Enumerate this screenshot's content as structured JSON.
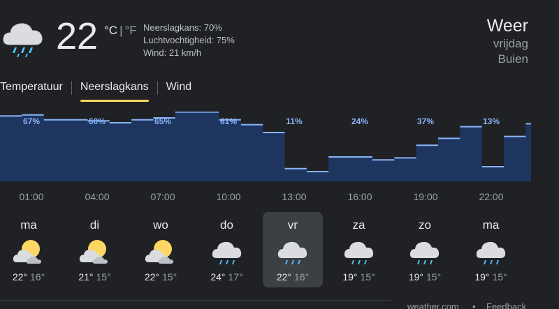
{
  "current": {
    "icon": "rain-cloud-icon",
    "temperature": "22",
    "unit_c": "°C",
    "unit_sep": "|",
    "unit_f": "°F",
    "precipitation": "Neerslagkans: 70%",
    "humidity": "Luchtvochtigheid: 75%",
    "wind": "Wind: 21 km/h"
  },
  "header": {
    "title": "Weer",
    "day": "vrijdag",
    "condition": "Buien"
  },
  "tabs": [
    {
      "label": "Temperatuur",
      "active": false
    },
    {
      "label": "Neerslagkans",
      "active": true
    },
    {
      "label": "Wind",
      "active": false
    }
  ],
  "chart_data": {
    "type": "area",
    "title": "",
    "xlabel": "",
    "ylabel": "",
    "ylim": [
      0,
      100
    ],
    "x_tick_labels": [
      "01:00",
      "04:00",
      "07:00",
      "10:00",
      "13:00",
      "16:00",
      "19:00",
      "22:00"
    ],
    "data_labels": [
      "67%",
      "60%",
      "65%",
      "61%",
      "11%",
      "24%",
      "37%",
      "13%"
    ],
    "series": [
      {
        "values": [
          67,
          68,
          63,
          63,
          62,
          60,
          63,
          65,
          71,
          71,
          63,
          58,
          50,
          13,
          10,
          25,
          25,
          22,
          24,
          37,
          44,
          56,
          15,
          46,
          59
        ]
      }
    ],
    "colors": {
      "fill": "#1e3560",
      "line": "#8ab4f8",
      "label": "#8ab4f8"
    }
  },
  "forecast": [
    {
      "day": "ma",
      "icon": "partly-cloudy-icon",
      "high": "22°",
      "low": "16°",
      "selected": false
    },
    {
      "day": "di",
      "icon": "partly-cloudy-icon",
      "high": "21°",
      "low": "15°",
      "selected": false
    },
    {
      "day": "wo",
      "icon": "partly-cloudy-icon",
      "high": "22°",
      "low": "15°",
      "selected": false
    },
    {
      "day": "do",
      "icon": "rain-cloud-icon",
      "high": "24°",
      "low": "17°",
      "selected": false
    },
    {
      "day": "vr",
      "icon": "rain-cloud-icon",
      "high": "22°",
      "low": "16°",
      "selected": true
    },
    {
      "day": "za",
      "icon": "rain-cloud-icon",
      "high": "19°",
      "low": "15°",
      "selected": false
    },
    {
      "day": "zo",
      "icon": "rain-cloud-icon",
      "high": "19°",
      "low": "15°",
      "selected": false
    },
    {
      "day": "ma",
      "icon": "rain-cloud-icon",
      "high": "19°",
      "low": "15°",
      "selected": false
    }
  ],
  "footer": {
    "source": "weather.com",
    "dot": "•",
    "feedback": "Feedback"
  },
  "colors": {
    "background": "#202124",
    "tab_indicator": "#fdd663",
    "selected_day": "#3c4043",
    "sun": "#fdd663",
    "rain": "#4fc3f7"
  }
}
